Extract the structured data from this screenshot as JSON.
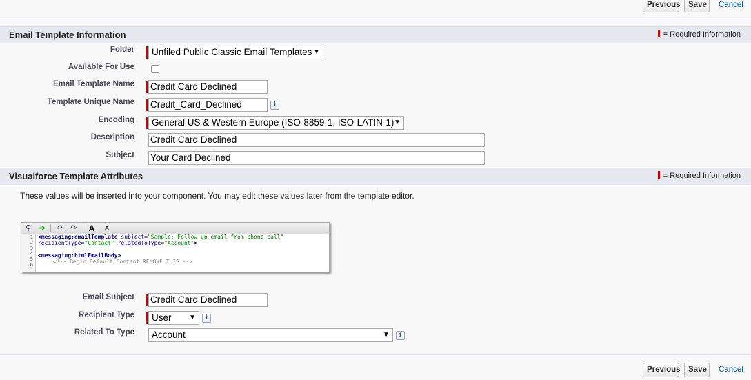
{
  "top_buttons": {
    "previous": "Previous",
    "save": "Save",
    "cancel": "Cancel"
  },
  "bottom_buttons": {
    "previous": "Previous",
    "save": "Save",
    "cancel": "Cancel"
  },
  "section1": {
    "title": "Email Template Information",
    "required_legend": "= Required Information",
    "fields": {
      "folder": {
        "label": "Folder",
        "value": "Unfiled Public Classic Email Templates"
      },
      "available": {
        "label": "Available For Use",
        "checked": false
      },
      "template_name": {
        "label": "Email Template Name",
        "value": "Credit Card Declined"
      },
      "unique_name": {
        "label": "Template Unique Name",
        "value": "Credit_Card_Declined"
      },
      "encoding": {
        "label": "Encoding",
        "value": "General US & Western Europe (ISO-8859-1, ISO-LATIN-1)"
      },
      "description": {
        "label": "Description",
        "value": "Credit Card Declined"
      },
      "subject": {
        "label": "Subject",
        "value": "Your Card Declined"
      }
    }
  },
  "section2": {
    "title": "Visualforce Template Attributes",
    "required_legend": "= Required Information",
    "description": "These values will be inserted into your component. You may edit these values later from the template editor.",
    "editor": {
      "line_numbers": [
        "1",
        "2",
        "3",
        "4",
        "5",
        "6"
      ],
      "toolbar": {
        "bold_a": "A",
        "small_a": "A"
      },
      "code": {
        "l1_tag": "<messaging:emailTemplate",
        "l1_attr": "subject=",
        "l1_val": "\"Sample: Follow up email from phone call\"",
        "l2_attr1": "recipientType=",
        "l2_val1": "\"Contact\"",
        "l2_attr2": "relatedToType=",
        "l2_val2": "\"Account\"",
        "l2_end": ">",
        "l4_tag": "<messaging:htmlEmailBody>",
        "l5_cmt": "<!-- Begin Default Content REMOVE THIS -->"
      }
    },
    "fields": {
      "email_subject": {
        "label": "Email Subject",
        "value": "Credit Card Declined"
      },
      "recipient_type": {
        "label": "Recipient Type",
        "value": "User"
      },
      "related_to_type": {
        "label": "Related To Type",
        "value": "Account"
      }
    }
  },
  "icons": {
    "info": "i",
    "dropdown": "▼"
  },
  "colors": {
    "required": "#cc0000",
    "link": "#015ba7",
    "section_bg": "#e5e8ee"
  }
}
